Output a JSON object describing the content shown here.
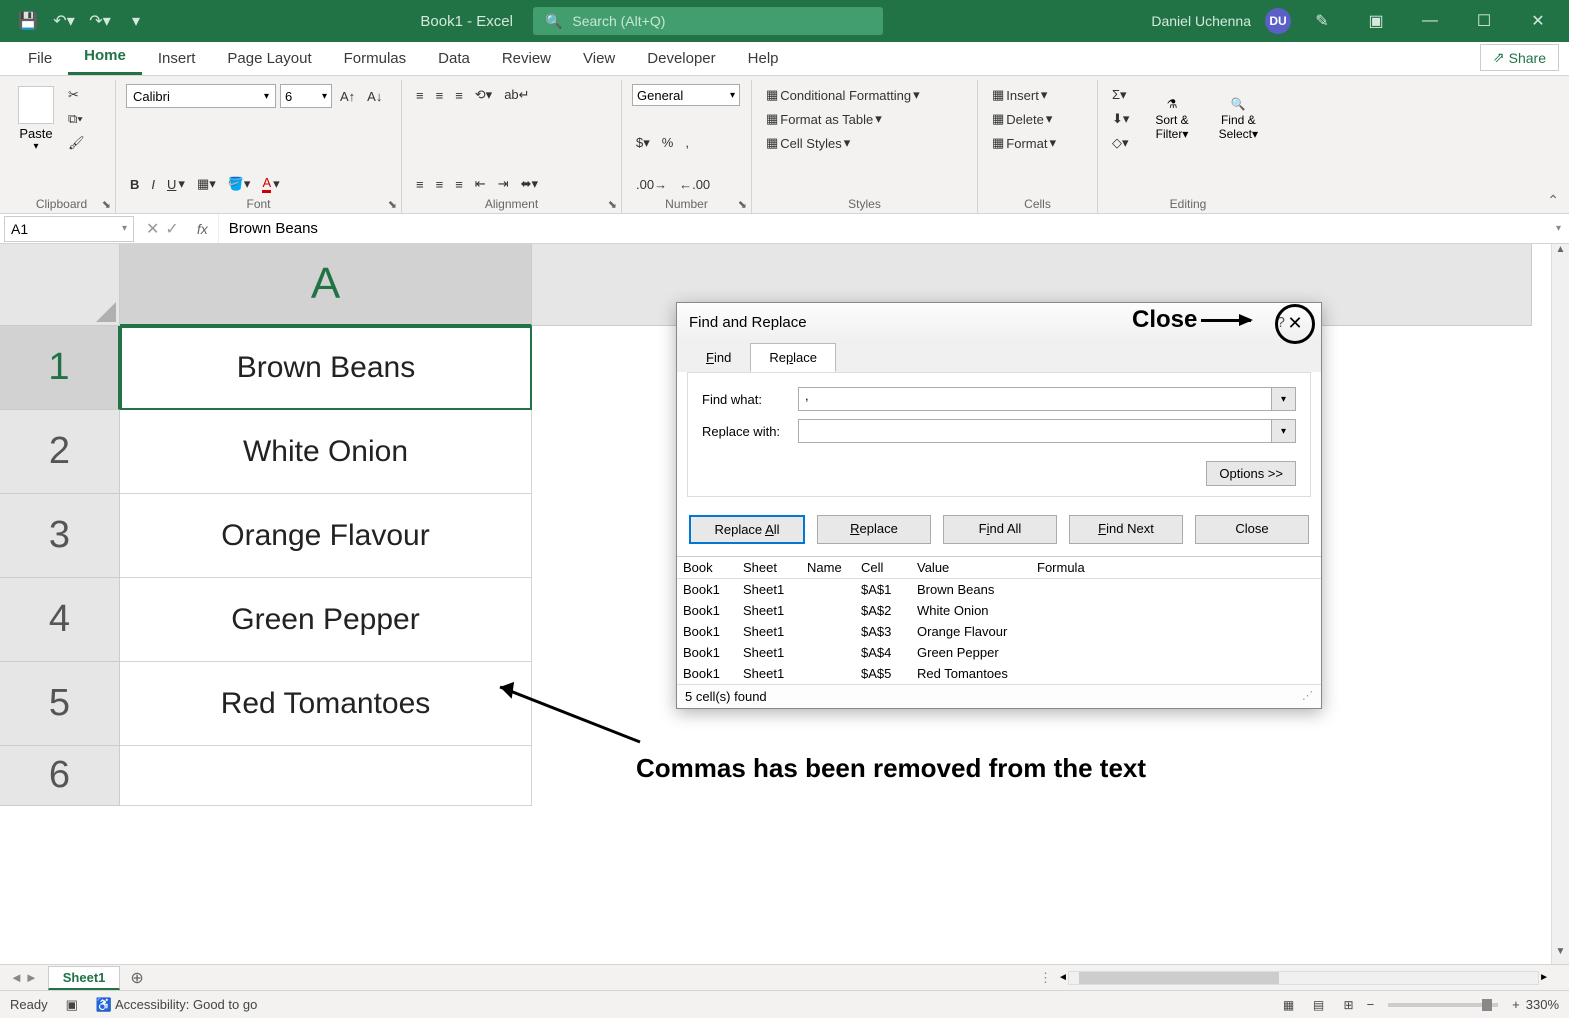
{
  "title_bar": {
    "doc_title": "Book1 - Excel",
    "search_placeholder": "Search (Alt+Q)",
    "user_name": "Daniel Uchenna",
    "user_initials": "DU"
  },
  "tabs": {
    "file": "File",
    "home": "Home",
    "insert": "Insert",
    "page_layout": "Page Layout",
    "formulas": "Formulas",
    "data": "Data",
    "review": "Review",
    "view": "View",
    "developer": "Developer",
    "help": "Help",
    "share": "Share"
  },
  "ribbon": {
    "clipboard": {
      "label": "Clipboard",
      "paste": "Paste"
    },
    "font": {
      "label": "Font",
      "name": "Calibri",
      "size": "6"
    },
    "alignment": {
      "label": "Alignment"
    },
    "number": {
      "label": "Number",
      "format": "General"
    },
    "styles": {
      "label": "Styles",
      "conditional": "Conditional Formatting",
      "table": "Format as Table",
      "cell": "Cell Styles"
    },
    "cells": {
      "label": "Cells",
      "insert": "Insert",
      "delete": "Delete",
      "format": "Format"
    },
    "editing": {
      "label": "Editing",
      "sort": "Sort & Filter",
      "find": "Find & Select"
    }
  },
  "formula_bar": {
    "name_box": "A1",
    "formula": "Brown Beans"
  },
  "grid": {
    "col_A": "A",
    "rows": [
      "1",
      "2",
      "3",
      "4",
      "5",
      "6"
    ],
    "data": [
      "Brown Beans",
      "White Onion",
      "Orange Flavour",
      "Green Pepper",
      "Red Tomantoes"
    ]
  },
  "dialog": {
    "title": "Find and Replace",
    "tab_find": "Find",
    "tab_replace": "Replace",
    "find_what_label": "Find what:",
    "find_what_value": ",",
    "replace_with_label": "Replace with:",
    "replace_with_value": "",
    "options": "Options >>",
    "btn_replace_all": "Replace All",
    "btn_replace": "Replace",
    "btn_find_all": "Find All",
    "btn_find_next": "Find Next",
    "btn_close": "Close",
    "headers": {
      "book": "Book",
      "sheet": "Sheet",
      "name": "Name",
      "cell": "Cell",
      "value": "Value",
      "formula": "Formula"
    },
    "results": [
      {
        "book": "Book1",
        "sheet": "Sheet1",
        "name": "",
        "cell": "$A$1",
        "value": "Brown Beans"
      },
      {
        "book": "Book1",
        "sheet": "Sheet1",
        "name": "",
        "cell": "$A$2",
        "value": "White Onion"
      },
      {
        "book": "Book1",
        "sheet": "Sheet1",
        "name": "",
        "cell": "$A$3",
        "value": "Orange Flavour"
      },
      {
        "book": "Book1",
        "sheet": "Sheet1",
        "name": "",
        "cell": "$A$4",
        "value": "Green Pepper"
      },
      {
        "book": "Book1",
        "sheet": "Sheet1",
        "name": "",
        "cell": "$A$5",
        "value": "Red Tomantoes"
      }
    ],
    "footer": "5 cell(s) found"
  },
  "annotations": {
    "close": "Close",
    "comment": "Commas has been removed from the text"
  },
  "sheet_bar": {
    "sheet1": "Sheet1"
  },
  "status_bar": {
    "ready": "Ready",
    "accessibility": "Accessibility: Good to go",
    "zoom": "330%"
  }
}
